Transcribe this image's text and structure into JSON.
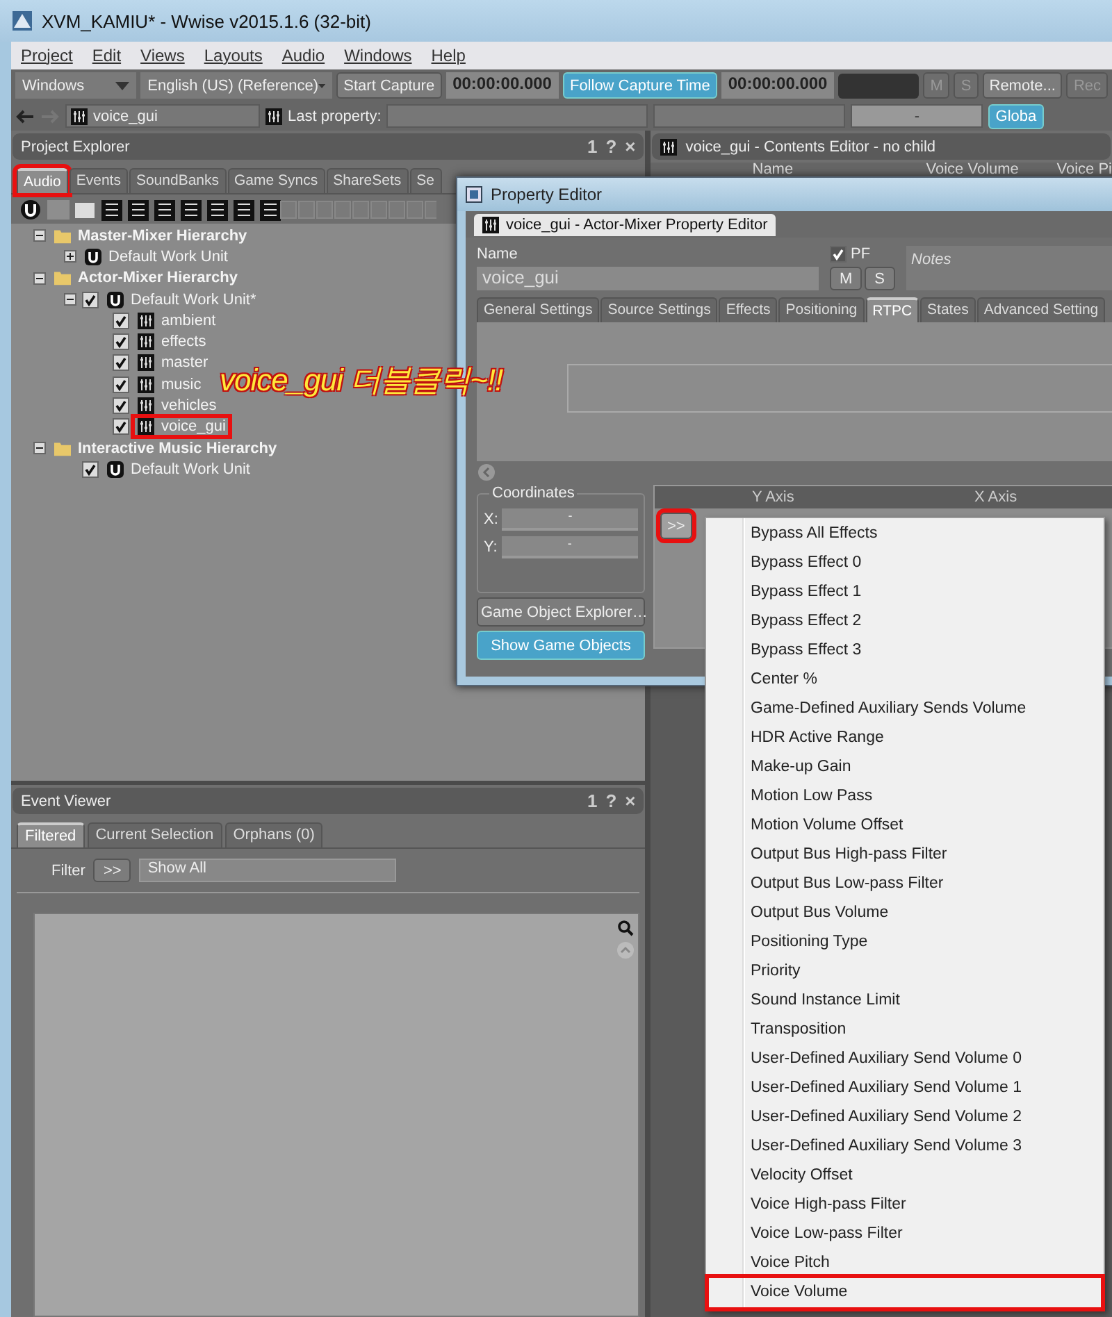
{
  "window": {
    "title": "XVM_KAMIU* - Wwise v2015.1.6 (32-bit)"
  },
  "menu_bar": [
    "Project",
    "Edit",
    "Views",
    "Layouts",
    "Audio",
    "Windows",
    "Help"
  ],
  "toolbar": {
    "platform": "Windows",
    "language": "English (US) (Reference)",
    "start_capture": "Start Capture",
    "time_1": "00:00:00.000",
    "follow_capture": "Follow Capture Time",
    "time_2": "00:00:00.000",
    "m": "M",
    "s": "S",
    "remote": "Remote...",
    "rec": "Rec"
  },
  "nav_bar": {
    "object": "voice_gui",
    "last_property_label": "Last property:",
    "value": "-",
    "global": "Globa"
  },
  "project_explorer": {
    "title": "Project Explorer",
    "controls": [
      "1",
      "?",
      "×"
    ],
    "tabs": [
      {
        "label": "Audio",
        "selected": true,
        "highlighted": true
      },
      {
        "label": "Events",
        "selected": false,
        "highlighted": false
      },
      {
        "label": "SoundBanks",
        "selected": false,
        "highlighted": false
      },
      {
        "label": "Game Syncs",
        "selected": false,
        "highlighted": false
      },
      {
        "label": "ShareSets",
        "selected": false,
        "highlighted": false
      },
      {
        "label": "Se",
        "selected": false,
        "highlighted": false
      }
    ],
    "tree": [
      {
        "kind": "folder",
        "label": "Master-Mixer Hierarchy",
        "expanded": true,
        "highlighted": false,
        "children": [
          {
            "kind": "workunit",
            "label": "Default Work Unit",
            "expanded": false,
            "highlighted": false
          }
        ]
      },
      {
        "kind": "folder",
        "label": "Actor-Mixer Hierarchy",
        "expanded": true,
        "highlighted": false,
        "children": [
          {
            "kind": "workunit",
            "label": "Default Work Unit*",
            "expanded": true,
            "checked": true,
            "highlighted": false,
            "children": [
              {
                "kind": "mixer",
                "label": "ambient",
                "checked": true,
                "highlighted": false
              },
              {
                "kind": "mixer",
                "label": "effects",
                "checked": true,
                "highlighted": false
              },
              {
                "kind": "mixer",
                "label": "master",
                "checked": true,
                "highlighted": false
              },
              {
                "kind": "mixer",
                "label": "music",
                "checked": true,
                "highlighted": false
              },
              {
                "kind": "mixer",
                "label": "vehicles",
                "checked": true,
                "highlighted": false
              },
              {
                "kind": "mixer",
                "label": "voice_gui",
                "checked": true,
                "highlighted": true
              }
            ]
          }
        ]
      },
      {
        "kind": "folder",
        "label": "Interactive Music Hierarchy",
        "expanded": true,
        "highlighted": false,
        "children": [
          {
            "kind": "workunit",
            "label": "Default Work Unit",
            "checked": true,
            "highlighted": false
          }
        ]
      }
    ]
  },
  "annotation": "voice_gui 더블클릭~!!",
  "event_viewer": {
    "title": "Event Viewer",
    "controls": [
      "1",
      "?",
      "×"
    ],
    "tabs": [
      {
        "label": "Filtered",
        "selected": true
      },
      {
        "label": "Current Selection",
        "selected": false
      },
      {
        "label": "Orphans (0)",
        "selected": false
      }
    ],
    "filter_label": "Filter",
    "filter_button": ">>",
    "filter_value": "Show All"
  },
  "contents_editor": {
    "title": "voice_gui - Contents Editor - no child",
    "columns": [
      "Name",
      "Voice Volume",
      "Voice Pi"
    ]
  },
  "property_editor": {
    "title": "Property Editor",
    "tab": "voice_gui - Actor-Mixer Property Editor",
    "name_label": "Name",
    "name_value": "voice_gui",
    "pf": {
      "label": "PF",
      "checked": true
    },
    "m": "M",
    "s": "S",
    "notes_placeholder": "Notes",
    "tabs": [
      {
        "label": "General Settings",
        "selected": false
      },
      {
        "label": "Source Settings",
        "selected": false
      },
      {
        "label": "Effects",
        "selected": false
      },
      {
        "label": "Positioning",
        "selected": false
      },
      {
        "label": "RTPC",
        "selected": true
      },
      {
        "label": "States",
        "selected": false
      },
      {
        "label": "Advanced Setting",
        "selected": false
      }
    ],
    "coordinates": {
      "title": "Coordinates",
      "x_label": "X:",
      "x_value": "-",
      "y_label": "Y:",
      "y_value": "-"
    },
    "game_object_explorer": "Game Object Explorer…",
    "show_game_objects": "Show Game Objects",
    "rtpc_columns": [
      "Y Axis",
      "X Axis"
    ],
    "add_button": {
      "label": ">>",
      "highlighted": true
    }
  },
  "popup_menu": [
    {
      "label": "Bypass All Effects",
      "highlighted": false
    },
    {
      "label": "Bypass Effect 0",
      "highlighted": false
    },
    {
      "label": "Bypass Effect 1",
      "highlighted": false
    },
    {
      "label": "Bypass Effect 2",
      "highlighted": false
    },
    {
      "label": "Bypass Effect 3",
      "highlighted": false
    },
    {
      "label": "Center %",
      "highlighted": false
    },
    {
      "label": "Game-Defined Auxiliary Sends Volume",
      "highlighted": false
    },
    {
      "label": "HDR Active Range",
      "highlighted": false
    },
    {
      "label": "Make-up Gain",
      "highlighted": false
    },
    {
      "label": "Motion Low Pass",
      "highlighted": false
    },
    {
      "label": "Motion Volume Offset",
      "highlighted": false
    },
    {
      "label": "Output Bus High-pass Filter",
      "highlighted": false
    },
    {
      "label": "Output Bus Low-pass Filter",
      "highlighted": false
    },
    {
      "label": "Output Bus Volume",
      "highlighted": false
    },
    {
      "label": "Positioning Type",
      "highlighted": false
    },
    {
      "label": "Priority",
      "highlighted": false
    },
    {
      "label": "Sound Instance Limit",
      "highlighted": false
    },
    {
      "label": "Transposition",
      "highlighted": false
    },
    {
      "label": "User-Defined Auxiliary Send Volume 0",
      "highlighted": false
    },
    {
      "label": "User-Defined Auxiliary Send Volume 1",
      "highlighted": false
    },
    {
      "label": "User-Defined Auxiliary Send Volume 2",
      "highlighted": false
    },
    {
      "label": "User-Defined Auxiliary Send Volume 3",
      "highlighted": false
    },
    {
      "label": "Velocity Offset",
      "highlighted": false
    },
    {
      "label": "Voice High-pass Filter",
      "highlighted": false
    },
    {
      "label": "Voice Low-pass Filter",
      "highlighted": false
    },
    {
      "label": "Voice Pitch",
      "highlighted": false
    },
    {
      "label": "Voice Volume",
      "highlighted": true
    }
  ]
}
